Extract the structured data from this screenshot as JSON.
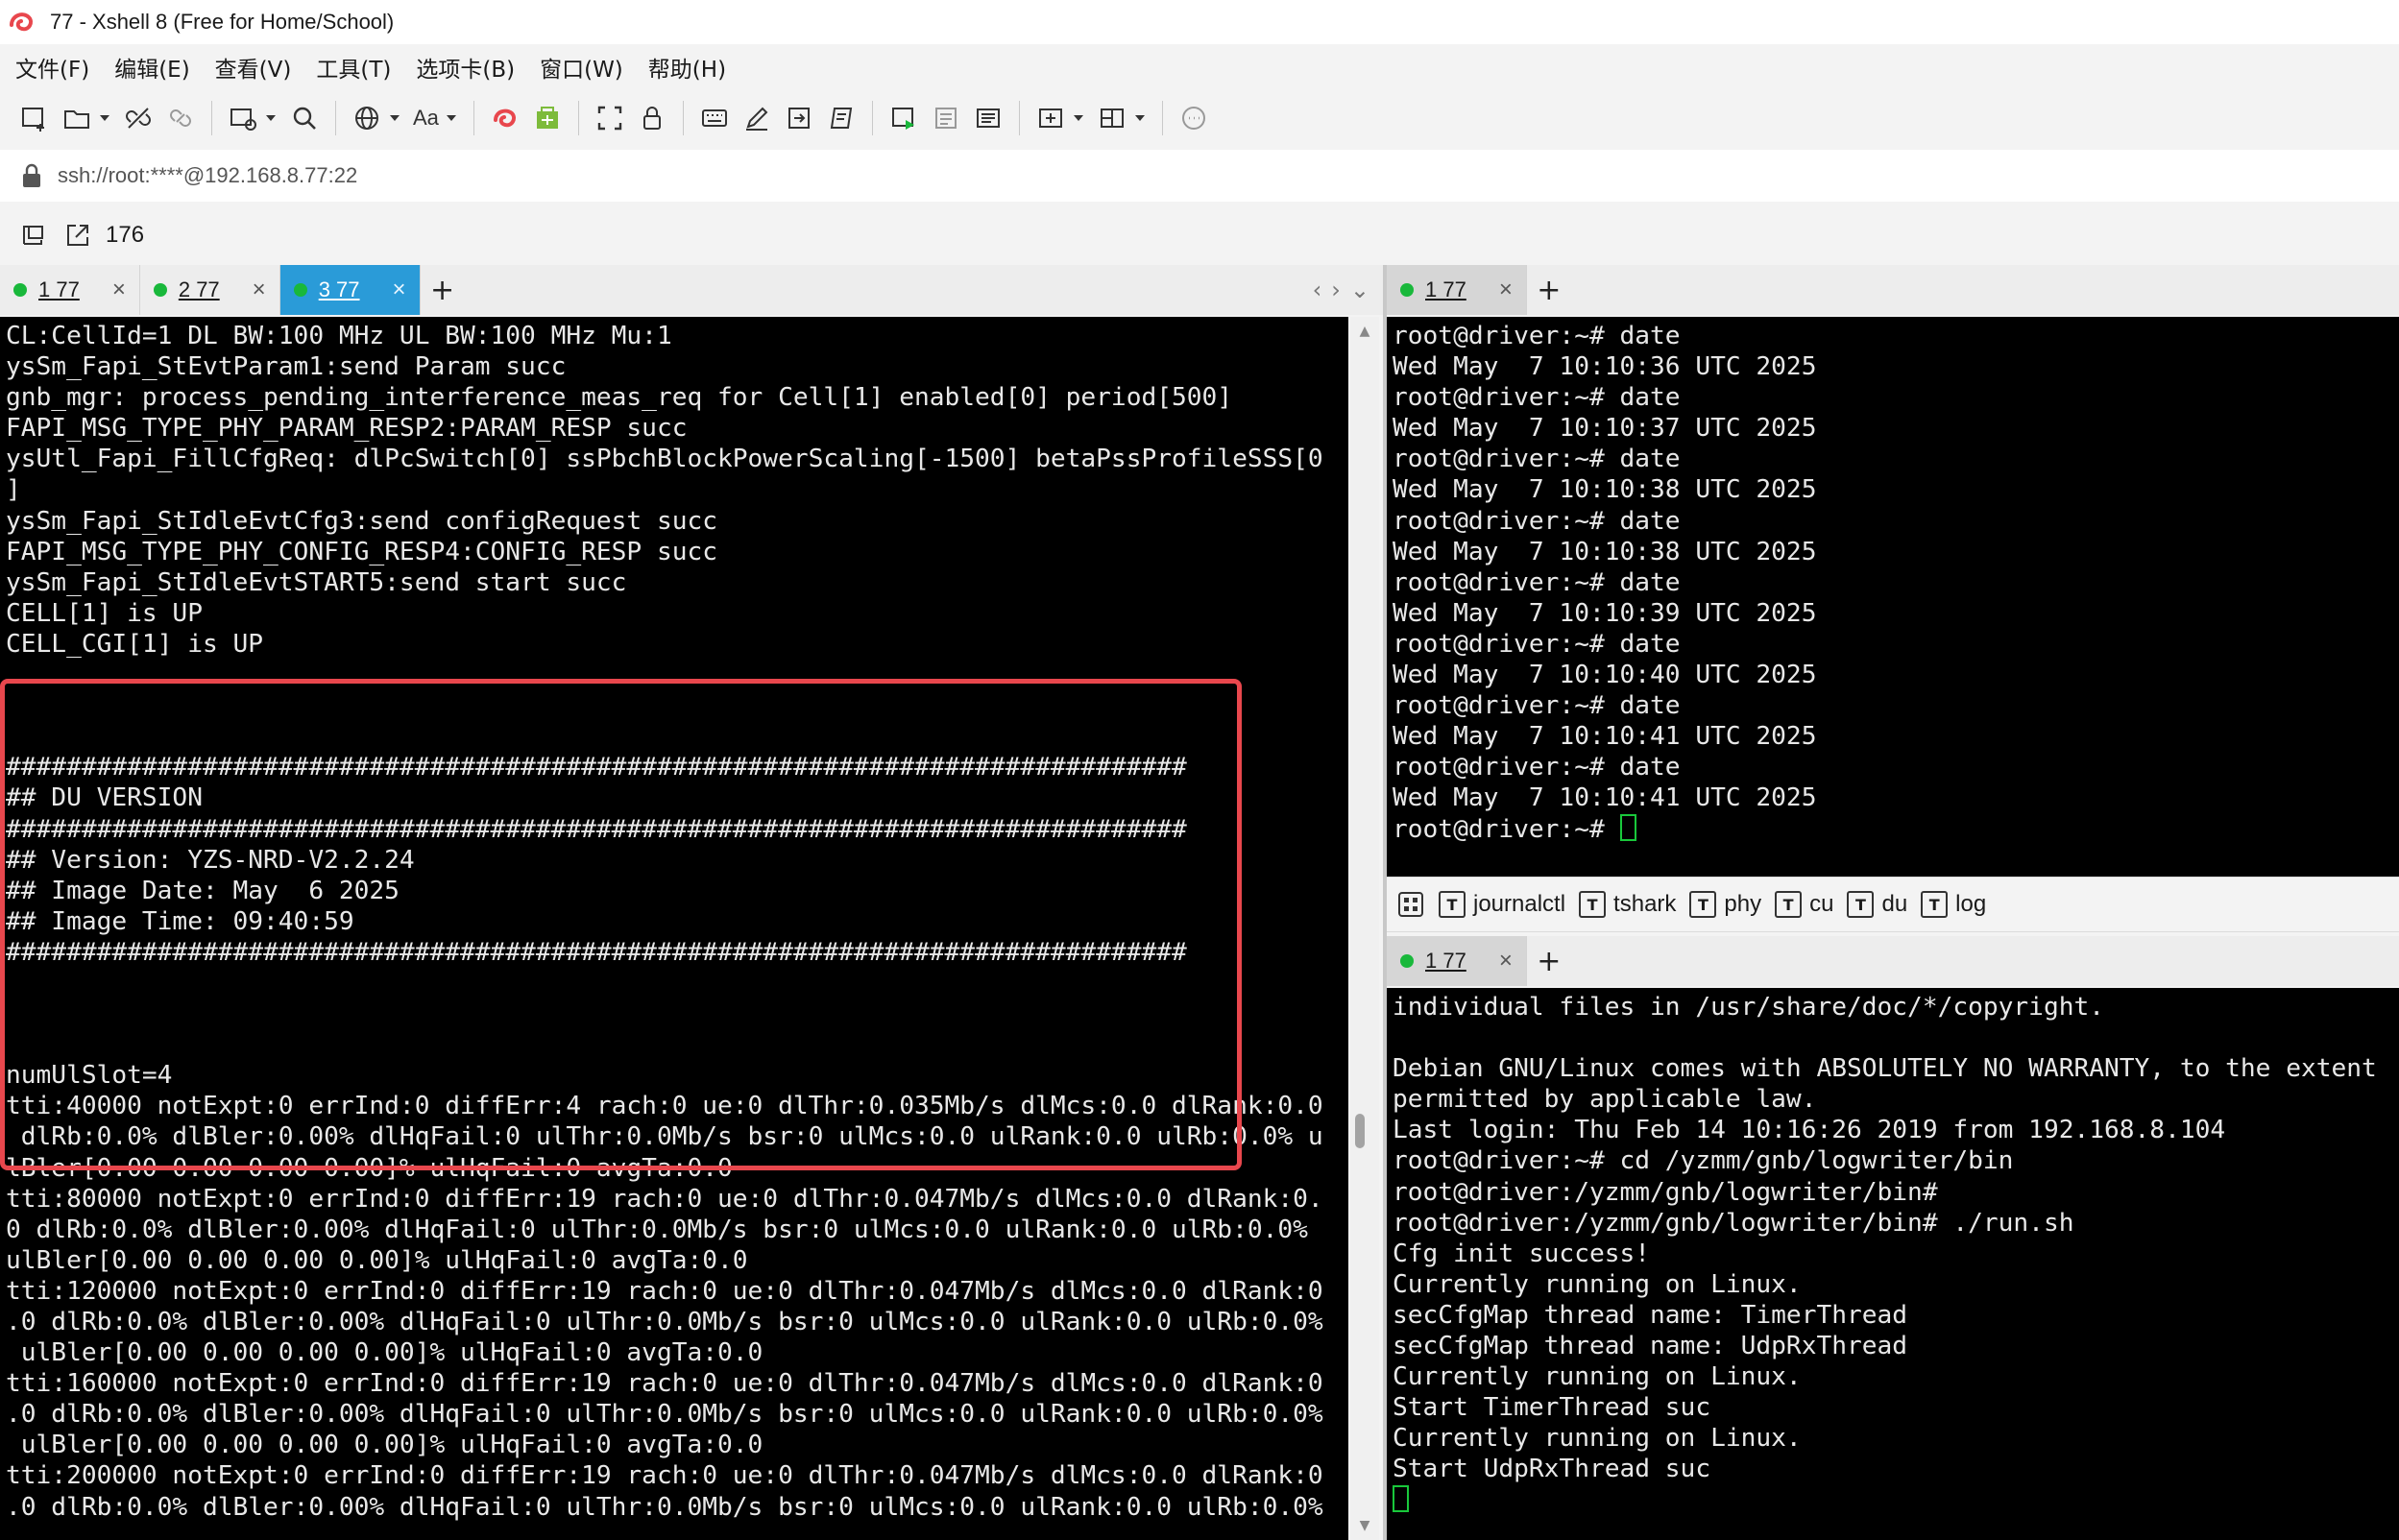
{
  "window": {
    "title": "77 - Xshell 8 (Free for Home/School)",
    "logo_icon": "xshell-logo-icon"
  },
  "menu": {
    "items": [
      "文件(F)",
      "编辑(E)",
      "查看(V)",
      "工具(T)",
      "选项卡(B)",
      "窗口(W)",
      "帮助(H)"
    ]
  },
  "toolbar": {
    "font_label": "Aa"
  },
  "address": {
    "text": "ssh://root:****@192.168.8.77:22"
  },
  "session_bar": {
    "count": "176"
  },
  "left_tabs": [
    {
      "label": "1 77",
      "active": false
    },
    {
      "label": "2 77",
      "active": false
    },
    {
      "label": "3 77",
      "active": true
    }
  ],
  "right_top_tab": {
    "label": "1 77"
  },
  "right_bottom_tab": {
    "label": "1 77"
  },
  "tab_controls": {
    "add": "+",
    "close": "×",
    "prev": "‹",
    "next": "›",
    "menu": "⌄"
  },
  "quick_commands": [
    "journalctl",
    "tshark",
    "phy",
    "cu",
    "du",
    "log"
  ],
  "left_terminal": {
    "lines": [
      "CL:CellId=1 DL BW:100 MHz UL BW:100 MHz Mu:1",
      "ysSm_Fapi_StEvtParam1:send Param succ",
      "gnb_mgr: process_pending_interference_meas_req for Cell[1] enabled[0] period[500]",
      "FAPI_MSG_TYPE_PHY_PARAM_RESP2:PARAM_RESP succ",
      "ysUtl_Fapi_FillCfgReq: dlPcSwitch[0] ssPbchBlockPowerScaling[-1500] betaPssProfileSSS[0",
      "]",
      "ysSm_Fapi_StIdleEvtCfg3:send configRequest succ",
      "FAPI_MSG_TYPE_PHY_CONFIG_RESP4:CONFIG_RESP succ",
      "ysSm_Fapi_StIdleEvtSTART5:send start succ",
      "CELL[1] is UP",
      "CELL_CGI[1] is UP",
      "",
      "",
      "",
      "##############################################################################",
      "## DU VERSION",
      "##############################################################################",
      "## Version: YZS-NRD-V2.2.24",
      "## Image Date: May  6 2025",
      "## Image Time: 09:40:59",
      "##############################################################################",
      "",
      "",
      "",
      "numUlSlot=4",
      "tti:40000 notExpt:0 errInd:0 diffErr:4 rach:0 ue:0 dlThr:0.035Mb/s dlMcs:0.0 dlRank:0.0",
      " dlRb:0.0% dlBler:0.00% dlHqFail:0 ulThr:0.0Mb/s bsr:0 ulMcs:0.0 ulRank:0.0 ulRb:0.0% u",
      "lBler[0.00 0.00 0.00 0.00]% ulHqFail:0 avgTa:0.0",
      "tti:80000 notExpt:0 errInd:0 diffErr:19 rach:0 ue:0 dlThr:0.047Mb/s dlMcs:0.0 dlRank:0.",
      "0 dlRb:0.0% dlBler:0.00% dlHqFail:0 ulThr:0.0Mb/s bsr:0 ulMcs:0.0 ulRank:0.0 ulRb:0.0%",
      "ulBler[0.00 0.00 0.00 0.00]% ulHqFail:0 avgTa:0.0",
      "tti:120000 notExpt:0 errInd:0 diffErr:19 rach:0 ue:0 dlThr:0.047Mb/s dlMcs:0.0 dlRank:0",
      ".0 dlRb:0.0% dlBler:0.00% dlHqFail:0 ulThr:0.0Mb/s bsr:0 ulMcs:0.0 ulRank:0.0 ulRb:0.0%",
      " ulBler[0.00 0.00 0.00 0.00]% ulHqFail:0 avgTa:0.0",
      "tti:160000 notExpt:0 errInd:0 diffErr:19 rach:0 ue:0 dlThr:0.047Mb/s dlMcs:0.0 dlRank:0",
      ".0 dlRb:0.0% dlBler:0.00% dlHqFail:0 ulThr:0.0Mb/s bsr:0 ulMcs:0.0 ulRank:0.0 ulRb:0.0%",
      " ulBler[0.00 0.00 0.00 0.00]% ulHqFail:0 avgTa:0.0",
      "tti:200000 notExpt:0 errInd:0 diffErr:19 rach:0 ue:0 dlThr:0.047Mb/s dlMcs:0.0 dlRank:0",
      ".0 dlRb:0.0% dlBler:0.00% dlHqFail:0 ulThr:0.0Mb/s bsr:0 ulMcs:0.0 ulRank:0.0 ulRb:0.0%"
    ]
  },
  "right_top_terminal": {
    "lines": [
      "root@driver:~# date",
      "Wed May  7 10:10:36 UTC 2025",
      "root@driver:~# date",
      "Wed May  7 10:10:37 UTC 2025",
      "root@driver:~# date",
      "Wed May  7 10:10:38 UTC 2025",
      "root@driver:~# date",
      "Wed May  7 10:10:38 UTC 2025",
      "root@driver:~# date",
      "Wed May  7 10:10:39 UTC 2025",
      "root@driver:~# date",
      "Wed May  7 10:10:40 UTC 2025",
      "root@driver:~# date",
      "Wed May  7 10:10:41 UTC 2025",
      "root@driver:~# date",
      "Wed May  7 10:10:41 UTC 2025"
    ],
    "prompt": "root@driver:~# "
  },
  "right_bottom_terminal": {
    "lines": [
      "individual files in /usr/share/doc/*/copyright.",
      "",
      "Debian GNU/Linux comes with ABSOLUTELY NO WARRANTY, to the extent",
      "permitted by applicable law.",
      "Last login: Thu Feb 14 10:16:26 2019 from 192.168.8.104",
      "root@driver:~# cd /yzmm/gnb/logwriter/bin",
      "root@driver:/yzmm/gnb/logwriter/bin#",
      "root@driver:/yzmm/gnb/logwriter/bin# ./run.sh",
      "Cfg init success!",
      "Currently running on Linux.",
      "secCfgMap thread name: TimerThread",
      "secCfgMap thread name: UdpRxThread",
      "Currently running on Linux.",
      "Start TimerThread suc",
      "Currently running on Linux.",
      "Start UdpRxThread suc"
    ]
  },
  "colors": {
    "active_tab": "#2a9bd8",
    "status_dot": "#19b83b",
    "highlight_border": "#e8474d",
    "cursor": "#19c83b"
  }
}
